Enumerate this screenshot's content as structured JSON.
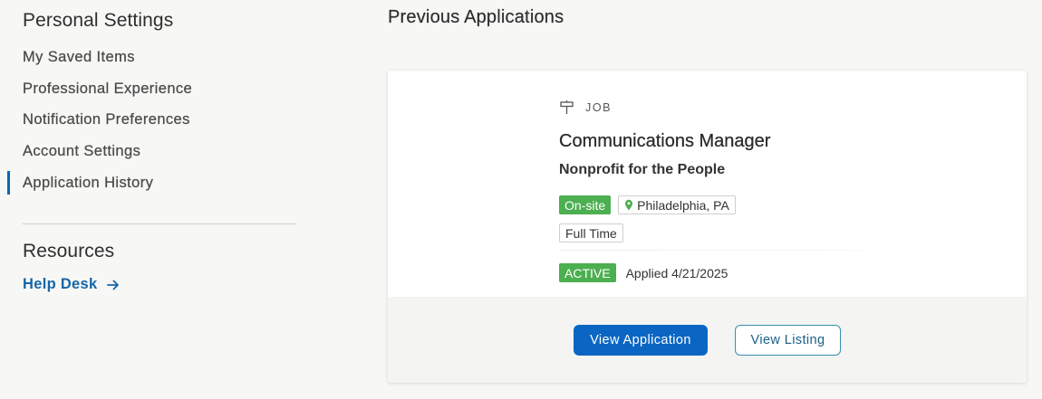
{
  "sidebar": {
    "personal_heading": "Personal Settings",
    "items": [
      {
        "label": "My Saved Items"
      },
      {
        "label": "Professional Experience"
      },
      {
        "label": "Notification Preferences"
      },
      {
        "label": "Account Settings"
      },
      {
        "label": "Application History",
        "active": true
      }
    ],
    "resources_heading": "Resources",
    "help_link": "Help Desk",
    "help_icon": "arrow-right-icon"
  },
  "main": {
    "title": "Previous Applications",
    "application": {
      "type_icon": "signpost-icon",
      "type": "JOB",
      "job_title": "Communications Manager",
      "organization": "Nonprofit for the People",
      "work_mode": "On-site",
      "location_icon": "map-pin-icon",
      "location": "Philadelphia, PA",
      "employment_type": "Full Time",
      "status": "ACTIVE",
      "applied": "Applied 4/21/2025",
      "view_application_label": "View Application",
      "view_listing_label": "View Listing"
    }
  },
  "colors": {
    "accent": "#0a66c2",
    "link": "#1565a8",
    "status_green": "#4caf50",
    "background": "#f7f7f5"
  }
}
